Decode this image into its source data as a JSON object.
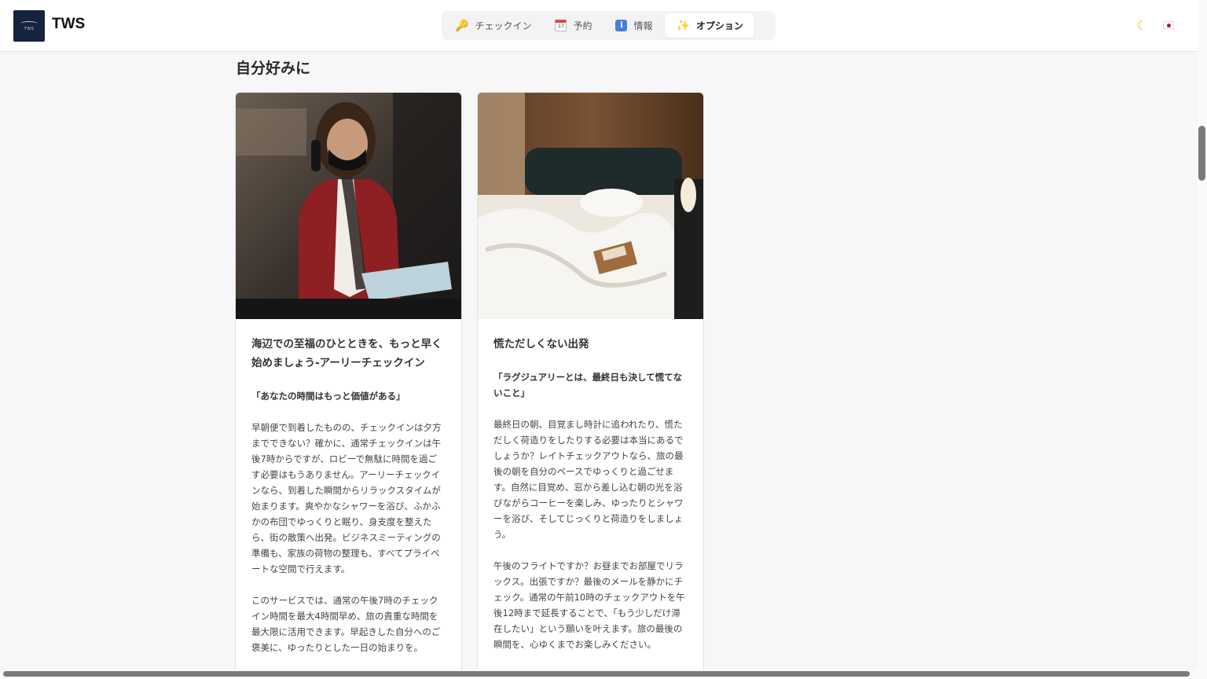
{
  "header": {
    "brand": "TWS",
    "logo_mini_text": "TWS",
    "nav": [
      {
        "label": "チェックイン",
        "icon": "key-icon"
      },
      {
        "label": "予約",
        "icon": "calendar-icon",
        "icon_text": "17"
      },
      {
        "label": "情報",
        "icon": "info-icon",
        "icon_text": "i"
      },
      {
        "label": "オプション",
        "icon": "sparkle-icon",
        "active": true
      }
    ],
    "theme_icon": "moon-icon",
    "language_flag": "japan-flag-icon"
  },
  "section": {
    "title": "自分好みに"
  },
  "cards": [
    {
      "image": "concierge-phone-photo",
      "title": "海辺での至福のひとときを、もっと早く始めましょう-アーリーチェックイン",
      "quote": "「あなたの時間はもっと価値がある」",
      "paragraphs": [
        "早朝便で到着したものの、チェックインは夕方までできない？確かに、通常チェックインは午後7時からですが、ロビーで無駄に時間を過ごす必要はもうありません。アーリーチェックインなら、到着した瞬間からリラックスタイムが始まります。爽やかなシャワーを浴び、ふかふかの布団でゆっくりと眠り、身支度を整えたら、街の散策へ出発。ビジネスミーティングの準備も、家族の荷物の整理も、すべてプライベートな空間で行えます。",
        "このサービスでは、通常の午後7時のチェックイン時間を最大4時間早め、旅の貴重な時間を最大限に活用できます。早起きした自分へのご褒美に、ゆったりとした一日の始まりを。"
      ]
    },
    {
      "image": "hotel-bed-photo",
      "title": "慌ただしくない出発",
      "quote": "「ラグジュアリーとは、最終日も決して慌てないこと」",
      "paragraphs": [
        "最終日の朝、目覚まし時計に追われたり、慌ただしく荷造りをしたりする必要は本当にあるでしょうか？レイトチェックアウトなら、旅の最後の朝を自分のペースでゆっくりと過ごせます。自然に目覚め、窓から差し込む朝の光を浴びながらコーヒーを楽しみ、ゆったりとシャワーを浴び、そしてじっくりと荷造りをしましょう。",
        "午後のフライトですか？お昼までお部屋でリラックス。出張ですか？最後のメールを静かにチェック。通常の午前10時のチェックアウトを午後12時まで延長することで、「もう少しだけ滞在したい」という願いを叶えます。旅の最後の瞬間を、心ゆくまでお楽しみください。"
      ]
    }
  ]
}
